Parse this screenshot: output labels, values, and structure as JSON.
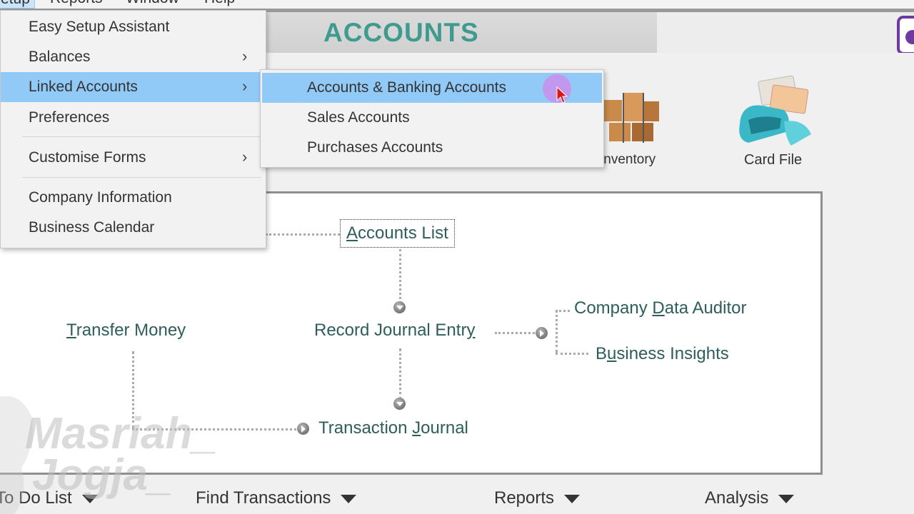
{
  "menubar": {
    "items": [
      "Setup",
      "Reports",
      "Window",
      "Help"
    ]
  },
  "header": {
    "title": "ACCOUNTS"
  },
  "command_icons": {
    "inventory_label": "Inventory",
    "card_file_label": "Card File"
  },
  "setup_menu": {
    "items": [
      {
        "label": "Easy Setup Assistant",
        "has_submenu": false
      },
      {
        "label": "Balances",
        "has_submenu": true
      },
      {
        "label": "Linked Accounts",
        "has_submenu": true,
        "highlighted": true
      },
      {
        "label": "Preferences",
        "has_submenu": false
      },
      {
        "label": "Customise Forms",
        "has_submenu": true
      },
      {
        "label": "Company Information",
        "has_submenu": false
      },
      {
        "label": "Business Calendar",
        "has_submenu": false
      }
    ],
    "chevron": "›"
  },
  "linked_submenu": {
    "items": [
      {
        "label": "Accounts & Banking Accounts",
        "highlighted": true
      },
      {
        "label": "Sales Accounts"
      },
      {
        "label": "Purchases Accounts"
      }
    ]
  },
  "flow": {
    "accounts_list": {
      "pre": "",
      "key": "A",
      "post": "ccounts List"
    },
    "transfer_money": {
      "pre": "",
      "key": "T",
      "post": "ransfer Money"
    },
    "record_journal_entry": {
      "pre": "Record Journal Entr",
      "key": "y",
      "post": ""
    },
    "company_data_auditor": {
      "pre": "Company ",
      "key": "D",
      "post": "ata Auditor"
    },
    "business_insights": {
      "pre": "B",
      "key": "u",
      "post": "siness Insights"
    },
    "transaction_journal": {
      "pre": "Transaction ",
      "key": "J",
      "post": "ournal"
    }
  },
  "bottombar": {
    "todo": "To Do List",
    "find": "Find Transactions",
    "reports": "Reports",
    "analysis": "Analysis"
  },
  "watermark": {
    "line1": "Masriah_",
    "line2": "Jogja_"
  },
  "colors": {
    "title_teal": "#3f9a8f",
    "menu_highlight": "#91c9f7",
    "flow_text": "#2e5d5b",
    "cursor_halo": "#e178e6"
  }
}
